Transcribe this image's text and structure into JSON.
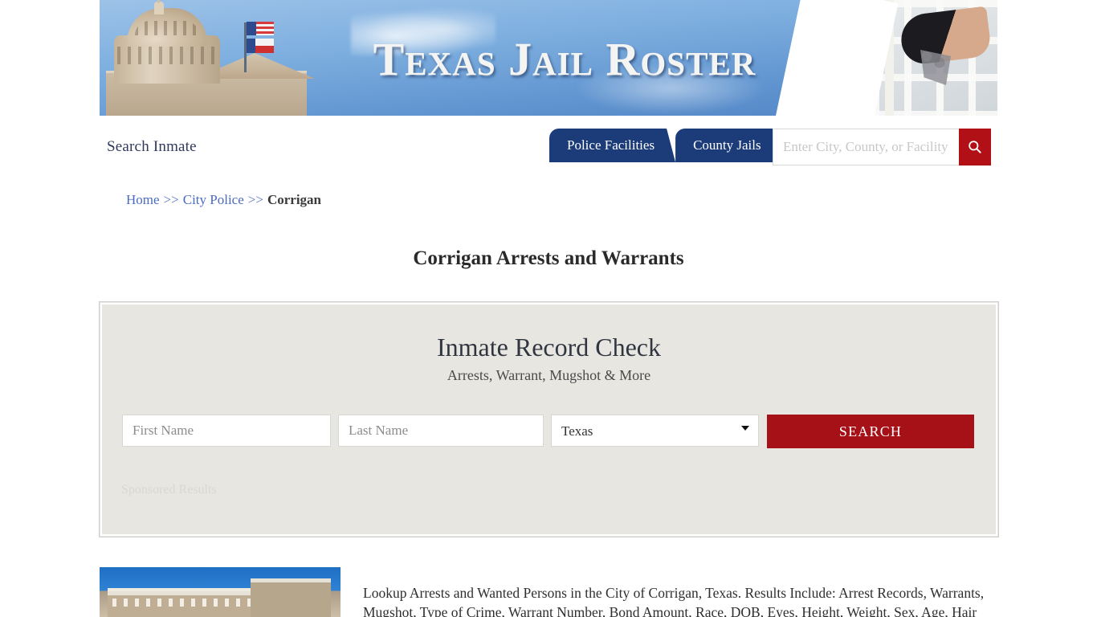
{
  "banner": {
    "title": "Texas Jail Roster",
    "left_image_alt": "texas-capitol-dome-photo",
    "right_image_alt": "jail-cell-door-with-hand-holding-keys-photo"
  },
  "nav": {
    "search_inmate_label": "Search Inmate",
    "tabs": [
      {
        "label": "Police Facilities",
        "active": true
      },
      {
        "label": "County Jails",
        "active": false
      }
    ],
    "search": {
      "value": "",
      "placeholder": "Enter City, County, or Facility",
      "button_icon": "search-icon"
    }
  },
  "breadcrumb": {
    "items": [
      {
        "label": "Home",
        "link": true
      },
      {
        "label": "City Police",
        "link": true
      },
      {
        "label": "Corrigan",
        "link": false
      }
    ],
    "separator": ">>"
  },
  "page": {
    "title": "Corrigan Arrests and Warrants"
  },
  "record_check": {
    "heading": "Inmate Record Check",
    "subheading": "Arrests, Warrant, Mugshot & More",
    "first_name": {
      "value": "",
      "placeholder": "First Name"
    },
    "last_name": {
      "value": "",
      "placeholder": "Last Name"
    },
    "state": {
      "selected": "Texas",
      "options": [
        "Texas"
      ]
    },
    "submit_label": "SEARCH",
    "sponsored_label": "Sponsored Results"
  },
  "content": {
    "image_alt": "corrigan-city-building-photo",
    "paragraph": "Lookup Arrests and Wanted Persons in the City of Corrigan, Texas. Results Include: Arrest Records, Warrants, Mugshot, Type of Crime, Warrant Number, Bond Amount, Race, DOB, Eyes, Height, Weight, Sex, Age, Hair"
  },
  "colors": {
    "navy": "#1c3b79",
    "red": "#a61118",
    "search_button_red": "#b11116",
    "panel_bg": "#e8e6e1",
    "link_blue": "#4a6bc4"
  }
}
